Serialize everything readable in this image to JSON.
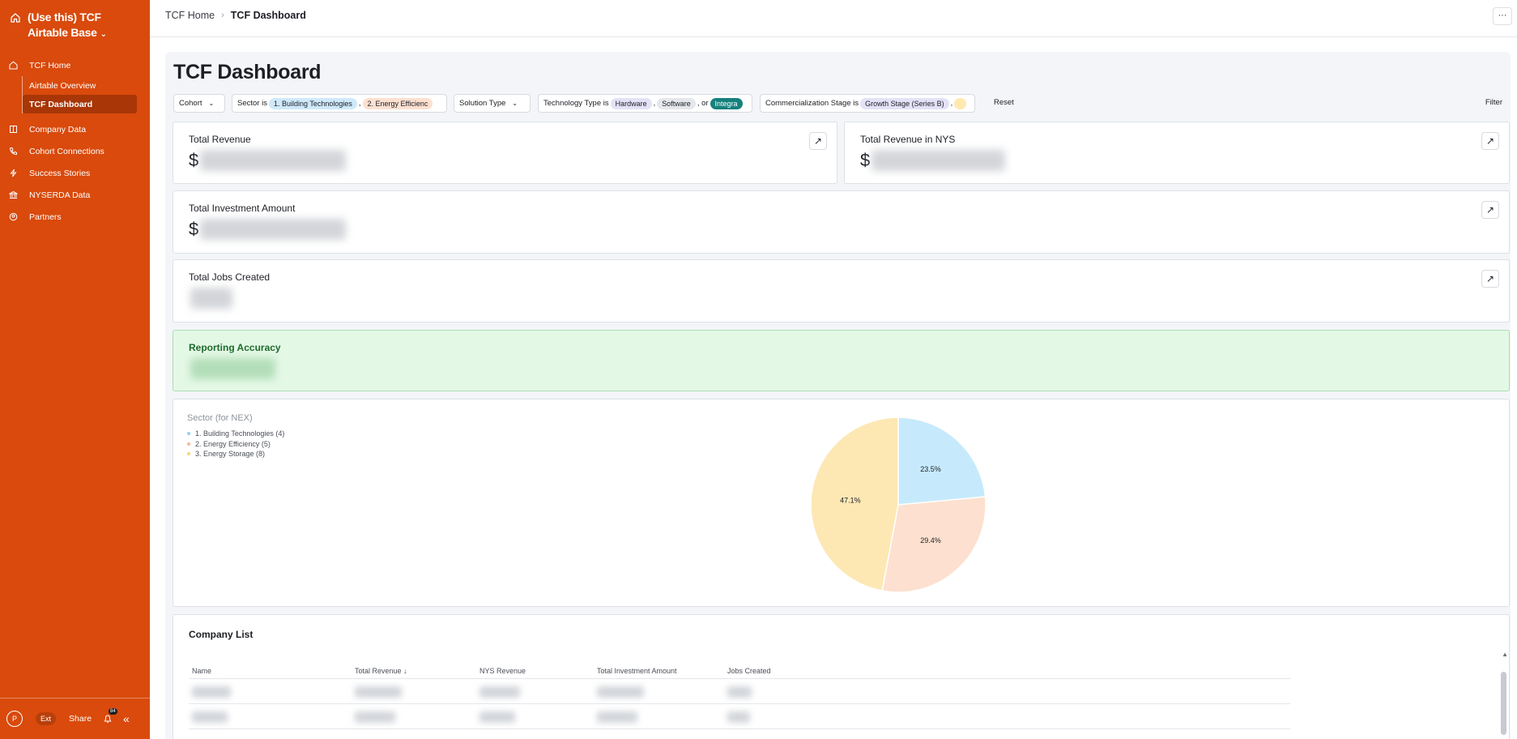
{
  "app": {
    "base_title_line1": "(Use this) TCF",
    "base_title_line2": "Airtable Base"
  },
  "sidebar": {
    "items": [
      {
        "label": "TCF Home"
      },
      {
        "label": "Airtable Overview"
      },
      {
        "label": "TCF Dashboard"
      },
      {
        "label": "Company Data"
      },
      {
        "label": "Cohort Connections"
      },
      {
        "label": "Success Stories"
      },
      {
        "label": "NYSERDA Data"
      },
      {
        "label": "Partners"
      }
    ],
    "footer": {
      "avatar": "P",
      "ext": "Ext",
      "share": "Share",
      "notifications": "84"
    }
  },
  "breadcrumb": {
    "home": "TCF Home",
    "current": "TCF Dashboard",
    "more": "···"
  },
  "page": {
    "title": "TCF Dashboard"
  },
  "filters": {
    "cohort": "Cohort",
    "sector_prefix": "Sector is",
    "sector_tags": [
      "1. Building Technologies",
      "2. Energy Efficienc"
    ],
    "solution_type": "Solution Type",
    "tech_prefix": "Technology Type is",
    "tech_tags": [
      "Hardware",
      "Software",
      "Integra"
    ],
    "tech_or": "or",
    "stage_prefix": "Commercialization Stage is",
    "stage_tags": [
      "Growth Stage (Series B)"
    ],
    "reset": "Reset",
    "filter": "Filter"
  },
  "cards": {
    "total_revenue": {
      "label": "Total Revenue",
      "currency": "$"
    },
    "total_revenue_nys": {
      "label": "Total Revenue in NYS",
      "currency": "$"
    },
    "total_investment": {
      "label": "Total Investment Amount",
      "currency": "$"
    },
    "total_jobs": {
      "label": "Total Jobs Created"
    },
    "reporting_accuracy": {
      "label": "Reporting Accuracy"
    }
  },
  "chart_data": {
    "type": "pie",
    "title": "Sector (for NEX)",
    "legend_placement": "top-left",
    "categories": [
      "1. Building Technologies (4)",
      "2. Energy Efficiency (5)",
      "3. Energy Storage (8)"
    ],
    "values": [
      4,
      5,
      8
    ],
    "percent_labels": [
      "23.5%",
      "29.4%",
      "47.1%"
    ],
    "colors": [
      "#c6eafc",
      "#fde0cf",
      "#fde8b4"
    ],
    "legend_dot_colors": [
      "#8fd0f3",
      "#f8b895",
      "#f7d57a"
    ]
  },
  "table": {
    "title": "Company List",
    "columns": [
      "Name",
      "Total Revenue",
      "NYS Revenue",
      "Total Investment Amount",
      "Jobs Created"
    ],
    "sort_indicator": "↓"
  },
  "colors": {
    "sidebar": "#d94a0c",
    "sidebar_active": "#a83607",
    "accuracy_bg": "#e4f8e6"
  }
}
